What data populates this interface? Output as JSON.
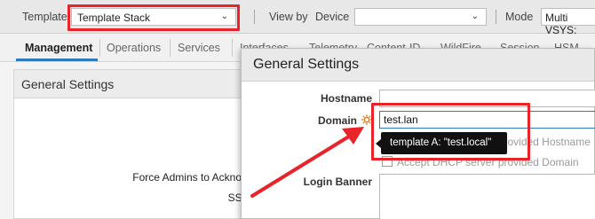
{
  "context_bar": {
    "template_label": "Template",
    "template_value": "Template Stack",
    "view_by_label": "View by",
    "device_label": "Device",
    "device_value": "",
    "mode_label": "Mode",
    "mode_value": "Multi VSYS;"
  },
  "tabs": [
    {
      "label": "Management",
      "active": true
    },
    {
      "label": "Operations"
    },
    {
      "label": "Services"
    },
    {
      "label": "Interfaces"
    },
    {
      "label": "Telemetry"
    },
    {
      "label": "Content-ID"
    },
    {
      "label": "WildFire"
    },
    {
      "label": "Session"
    },
    {
      "label": "HSM"
    }
  ],
  "background_panel": {
    "title": "General Settings",
    "row_force_admins": "Force Admins to Acknowle",
    "row_ssl": "SSL/T"
  },
  "modal": {
    "title": "General Settings",
    "hostname_label": "Hostname",
    "hostname_value": "",
    "domain_label": "Domain",
    "domain_value": "test.lan",
    "dhcp_hostname_label": "Accept DHCP server provided Hostname",
    "dhcp_domain_label": "Accept DHCP server provided Domain",
    "login_banner_label": "Login Banner"
  },
  "tooltip": {
    "text": "template A: \"test.local\""
  },
  "colors": {
    "highlight": "#e8232a",
    "accent": "#2f7abf",
    "gear": "#e07a1a"
  }
}
